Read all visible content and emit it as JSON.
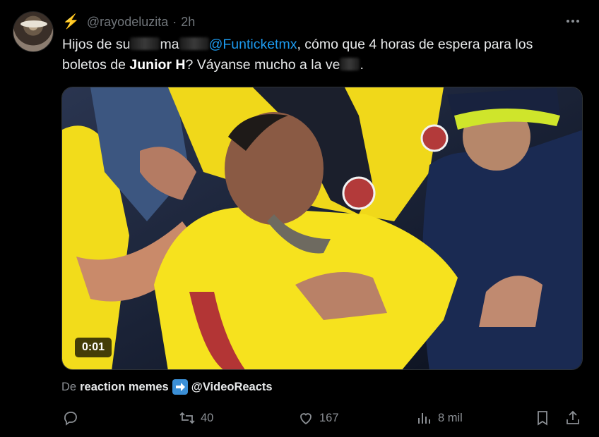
{
  "tweet": {
    "avatar_icon": "user-avatar-cowboy-hat",
    "badge_icon": "lightning-bolt-icon",
    "badge_glyph": "⚡",
    "username": "@rayodeluzita",
    "separator": "·",
    "time": "2h",
    "more_icon": "more-horizontal-icon",
    "text": {
      "seg1": "Hijos de su",
      "seg2": "ma",
      "mention": "@Funticketmx",
      "seg3": ", cómo que 4 horas de espera para los boletos de ",
      "bold": "Junior H",
      "seg4": "? Váyanse mucho a la ve",
      "seg5": "."
    },
    "media": {
      "type": "video",
      "duration": "0:01"
    },
    "source": {
      "prefix": "De",
      "name": "reaction memes",
      "arrow_icon": "right-arrow-emoji-icon",
      "handle": "@VideoReacts"
    },
    "actions": {
      "reply": {
        "icon": "reply-icon",
        "count": ""
      },
      "retweet": {
        "icon": "retweet-icon",
        "count": "40"
      },
      "like": {
        "icon": "heart-icon",
        "count": "167"
      },
      "views": {
        "icon": "views-chart-icon",
        "count": "8 mil"
      },
      "bookmark": {
        "icon": "bookmark-icon"
      },
      "share": {
        "icon": "share-icon"
      }
    },
    "colors": {
      "background": "#000000",
      "text": "#e7e9ea",
      "muted": "#71767b",
      "link": "#1d9bf0",
      "jersey_yellow": "#f5e11d"
    }
  }
}
